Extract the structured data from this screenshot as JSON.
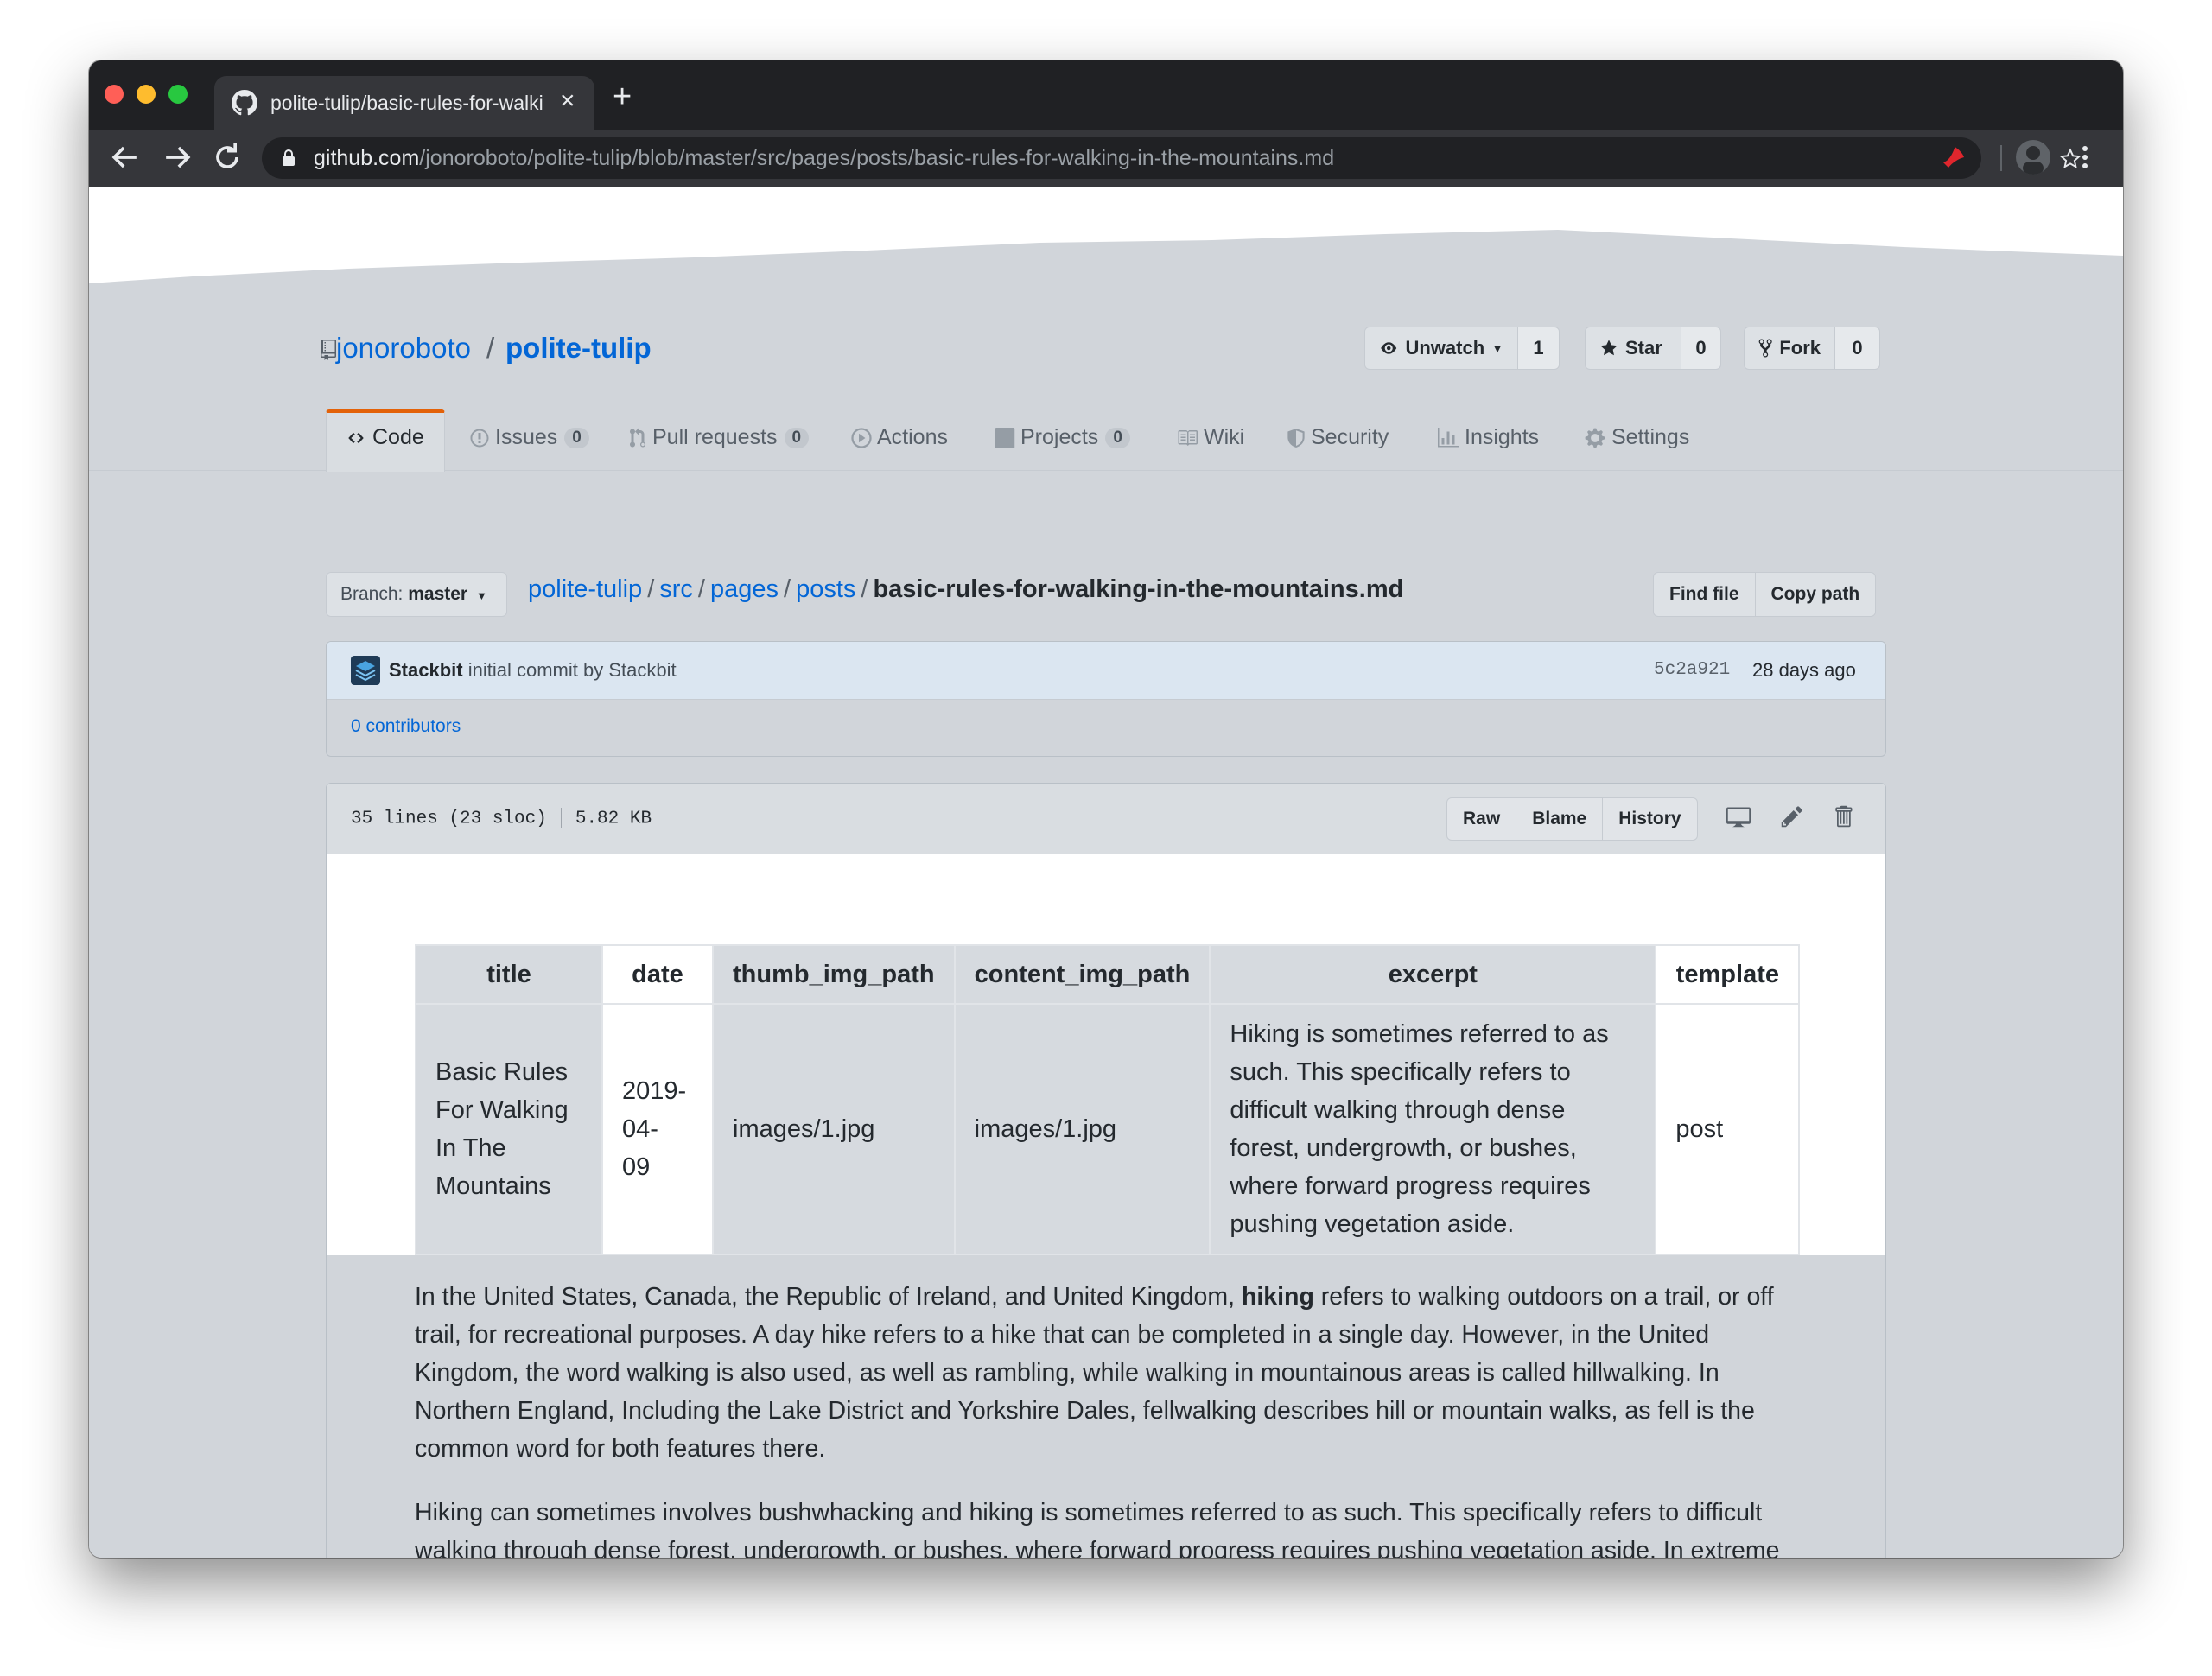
{
  "browser": {
    "tab_title": "polite-tulip/basic-rules-for-walking-in-the-mountains.md",
    "url_host": "github.com",
    "url_path": "/jonoroboto/polite-tulip/blob/master/src/pages/posts/basic-rules-for-walking-in-the-mountains.md"
  },
  "repo": {
    "owner": "jonoroboto",
    "separator": "/",
    "name": "polite-tulip",
    "unwatch_label": "Unwatch",
    "watch_count": "1",
    "star_label": "Star",
    "star_count": "0",
    "fork_label": "Fork",
    "fork_count": "0"
  },
  "nav": {
    "code": "Code",
    "issues": "Issues",
    "issues_count": "0",
    "pulls": "Pull requests",
    "pulls_count": "0",
    "actions": "Actions",
    "projects": "Projects",
    "projects_count": "0",
    "wiki": "Wiki",
    "security": "Security",
    "insights": "Insights",
    "settings": "Settings"
  },
  "path": {
    "branch_prefix": "Branch:",
    "branch": "master",
    "crumbs": [
      "polite-tulip",
      "src",
      "pages",
      "posts"
    ],
    "separator": "/",
    "file": "basic-rules-for-walking-in-the-mountains.md",
    "find_file": "Find file",
    "copy_path": "Copy path"
  },
  "commit": {
    "author": "Stackbit",
    "message": "initial commit by Stackbit",
    "sha": "5c2a921",
    "time": "28 days ago",
    "contributors": "0 contributors"
  },
  "file": {
    "lines": "35 lines (23 sloc)",
    "size": "5.82 KB",
    "raw": "Raw",
    "blame": "Blame",
    "history": "History"
  },
  "frontmatter": {
    "headers": [
      "title",
      "date",
      "thumb_img_path",
      "content_img_path",
      "excerpt",
      "template"
    ],
    "title_lines": [
      "Basic Rules",
      "For Walking",
      "In The",
      "Mountains"
    ],
    "date_lines": [
      "2019-",
      "04-",
      "09"
    ],
    "thumb_img_path": "images/1.jpg",
    "content_img_path": "images/1.jpg",
    "excerpt_lines": [
      "Hiking is sometimes referred to as",
      "such. This specifically refers to",
      "difficult walking through dense",
      "forest, undergrowth, or bushes,",
      "where forward progress requires",
      "pushing vegetation aside."
    ],
    "template": "post"
  },
  "content": {
    "p1_before": "In the United States, Canada, the Republic of Ireland, and United Kingdom,",
    "p1_bold": "hiking",
    "p1_after": "refers to walking outdoors on a trail, or off trail, for recreational purposes. A day hike refers to a hike that can be completed in a single day. However, in the United Kingdom, the word walking is also used, as well as rambling, while walking in mountainous areas is called hillwalking. In Northern England, Including the Lake District and Yorkshire Dales, fellwalking describes hill or mountain walks, as fell is the common word for both features there.",
    "p2": "Hiking can sometimes involves bushwhacking and hiking is sometimes referred to as such. This specifically refers to difficult walking through dense forest, undergrowth, or bushes, where forward progress requires pushing vegetation aside. In extreme cases of bushwhacking, where the vegetation is so dense that human passage is impeded, a machete is used to clear a"
  }
}
